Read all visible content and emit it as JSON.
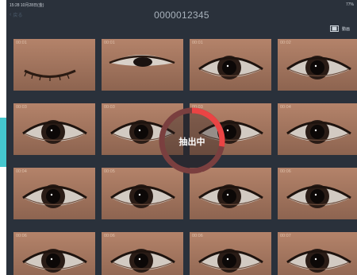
{
  "statusbar": {
    "time": "15:28 10月28日(金)",
    "battery": "77%"
  },
  "nav": {
    "back_label": "戻る",
    "title": "0000012345",
    "video_label": "動画"
  },
  "frames": [
    {
      "ts": "00:01",
      "eye": "closed"
    },
    {
      "ts": "00:01",
      "eye": "half"
    },
    {
      "ts": "00:01",
      "eye": "open"
    },
    {
      "ts": "00:02",
      "eye": "open"
    },
    {
      "ts": "00:03",
      "eye": "open"
    },
    {
      "ts": "00:03",
      "eye": "open"
    },
    {
      "ts": "00:03",
      "eye": "open"
    },
    {
      "ts": "00:04",
      "eye": "open"
    },
    {
      "ts": "00:04",
      "eye": "open"
    },
    {
      "ts": "00:05",
      "eye": "open"
    },
    {
      "ts": "00:06",
      "eye": "open"
    },
    {
      "ts": "00:06",
      "eye": "open"
    },
    {
      "ts": "00:06",
      "eye": "open"
    },
    {
      "ts": "00:06",
      "eye": "open"
    },
    {
      "ts": "00:06",
      "eye": "open"
    },
    {
      "ts": "00:07",
      "eye": "open"
    }
  ],
  "loader": {
    "label": "抽出中",
    "progress": 0.28,
    "track_color": "#7a3f3f",
    "arc_color": "#ea4444"
  },
  "colors": {
    "background": "#2a313b",
    "accent_tab": "#45c7cf"
  }
}
